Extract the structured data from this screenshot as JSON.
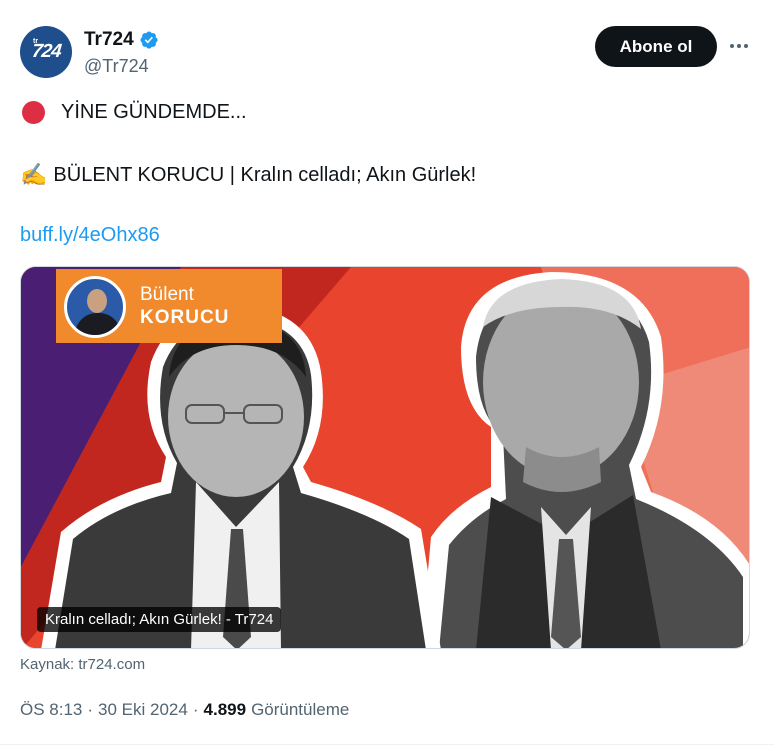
{
  "author": {
    "display_name": "Tr724",
    "handle": "@Tr724",
    "avatar_text": "724",
    "avatar_small_text": "tr"
  },
  "actions": {
    "follow_label": "Abone ol",
    "more_icon": "ellipsis-icon"
  },
  "tweet": {
    "line1": "YİNE GÜNDEMDE...",
    "line2": "BÜLENT KORUCU | Kralın celladı; Akın Gürlek!",
    "line2_emoji": "✍️",
    "link": "buff.ly/4eOhx86"
  },
  "card": {
    "banner_first": "Bülent",
    "banner_last": "KORUCU",
    "title": "Kralın celladı; Akın Gürlek! - Tr724",
    "source": "Kaynak: tr724.com"
  },
  "meta": {
    "time": "ÖS 8:13",
    "date": "30 Eki 2024",
    "views_count": "4.899",
    "views_label": "Görüntüleme"
  },
  "colors": {
    "accent": "#1d9bf0",
    "verified": "#1d9bf0",
    "card_red": "#e8442e",
    "card_purple": "#4a1f73",
    "banner_orange": "#f08a2c"
  }
}
